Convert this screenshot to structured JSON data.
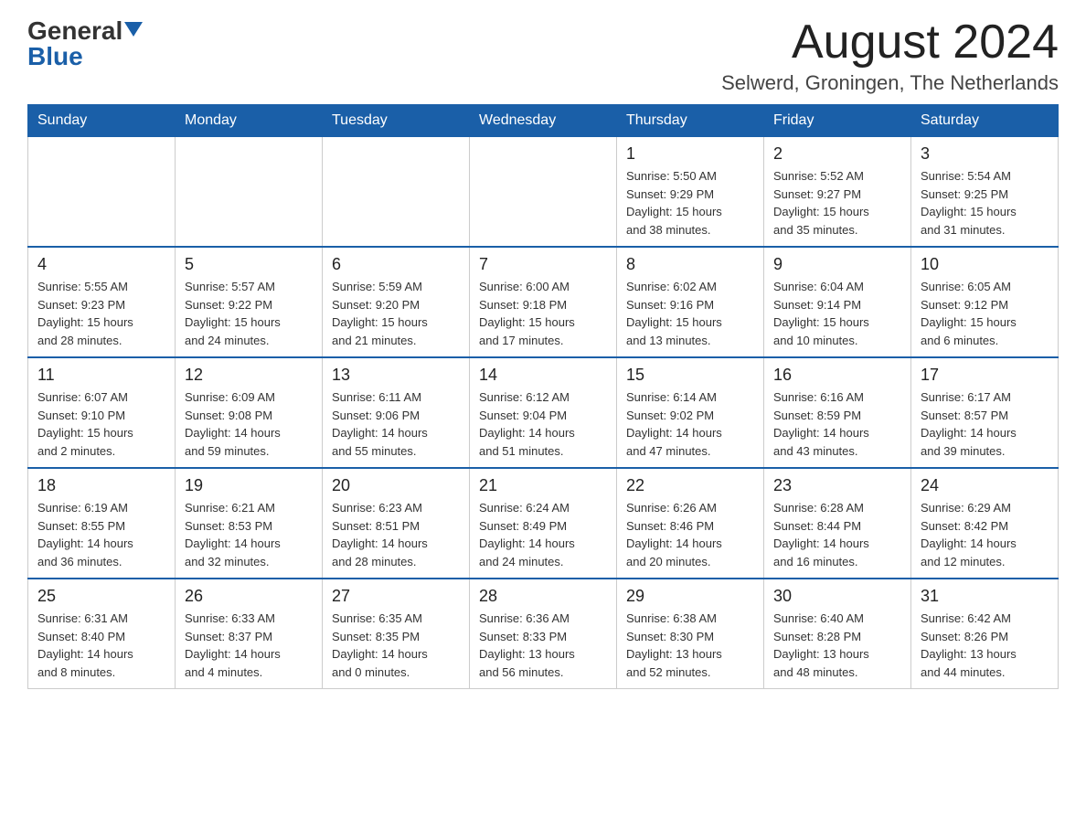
{
  "header": {
    "logo_general": "General",
    "logo_blue": "Blue",
    "month_title": "August 2024",
    "location": "Selwerd, Groningen, The Netherlands"
  },
  "weekdays": [
    "Sunday",
    "Monday",
    "Tuesday",
    "Wednesday",
    "Thursday",
    "Friday",
    "Saturday"
  ],
  "weeks": [
    [
      {
        "day": "",
        "info": ""
      },
      {
        "day": "",
        "info": ""
      },
      {
        "day": "",
        "info": ""
      },
      {
        "day": "",
        "info": ""
      },
      {
        "day": "1",
        "info": "Sunrise: 5:50 AM\nSunset: 9:29 PM\nDaylight: 15 hours\nand 38 minutes."
      },
      {
        "day": "2",
        "info": "Sunrise: 5:52 AM\nSunset: 9:27 PM\nDaylight: 15 hours\nand 35 minutes."
      },
      {
        "day": "3",
        "info": "Sunrise: 5:54 AM\nSunset: 9:25 PM\nDaylight: 15 hours\nand 31 minutes."
      }
    ],
    [
      {
        "day": "4",
        "info": "Sunrise: 5:55 AM\nSunset: 9:23 PM\nDaylight: 15 hours\nand 28 minutes."
      },
      {
        "day": "5",
        "info": "Sunrise: 5:57 AM\nSunset: 9:22 PM\nDaylight: 15 hours\nand 24 minutes."
      },
      {
        "day": "6",
        "info": "Sunrise: 5:59 AM\nSunset: 9:20 PM\nDaylight: 15 hours\nand 21 minutes."
      },
      {
        "day": "7",
        "info": "Sunrise: 6:00 AM\nSunset: 9:18 PM\nDaylight: 15 hours\nand 17 minutes."
      },
      {
        "day": "8",
        "info": "Sunrise: 6:02 AM\nSunset: 9:16 PM\nDaylight: 15 hours\nand 13 minutes."
      },
      {
        "day": "9",
        "info": "Sunrise: 6:04 AM\nSunset: 9:14 PM\nDaylight: 15 hours\nand 10 minutes."
      },
      {
        "day": "10",
        "info": "Sunrise: 6:05 AM\nSunset: 9:12 PM\nDaylight: 15 hours\nand 6 minutes."
      }
    ],
    [
      {
        "day": "11",
        "info": "Sunrise: 6:07 AM\nSunset: 9:10 PM\nDaylight: 15 hours\nand 2 minutes."
      },
      {
        "day": "12",
        "info": "Sunrise: 6:09 AM\nSunset: 9:08 PM\nDaylight: 14 hours\nand 59 minutes."
      },
      {
        "day": "13",
        "info": "Sunrise: 6:11 AM\nSunset: 9:06 PM\nDaylight: 14 hours\nand 55 minutes."
      },
      {
        "day": "14",
        "info": "Sunrise: 6:12 AM\nSunset: 9:04 PM\nDaylight: 14 hours\nand 51 minutes."
      },
      {
        "day": "15",
        "info": "Sunrise: 6:14 AM\nSunset: 9:02 PM\nDaylight: 14 hours\nand 47 minutes."
      },
      {
        "day": "16",
        "info": "Sunrise: 6:16 AM\nSunset: 8:59 PM\nDaylight: 14 hours\nand 43 minutes."
      },
      {
        "day": "17",
        "info": "Sunrise: 6:17 AM\nSunset: 8:57 PM\nDaylight: 14 hours\nand 39 minutes."
      }
    ],
    [
      {
        "day": "18",
        "info": "Sunrise: 6:19 AM\nSunset: 8:55 PM\nDaylight: 14 hours\nand 36 minutes."
      },
      {
        "day": "19",
        "info": "Sunrise: 6:21 AM\nSunset: 8:53 PM\nDaylight: 14 hours\nand 32 minutes."
      },
      {
        "day": "20",
        "info": "Sunrise: 6:23 AM\nSunset: 8:51 PM\nDaylight: 14 hours\nand 28 minutes."
      },
      {
        "day": "21",
        "info": "Sunrise: 6:24 AM\nSunset: 8:49 PM\nDaylight: 14 hours\nand 24 minutes."
      },
      {
        "day": "22",
        "info": "Sunrise: 6:26 AM\nSunset: 8:46 PM\nDaylight: 14 hours\nand 20 minutes."
      },
      {
        "day": "23",
        "info": "Sunrise: 6:28 AM\nSunset: 8:44 PM\nDaylight: 14 hours\nand 16 minutes."
      },
      {
        "day": "24",
        "info": "Sunrise: 6:29 AM\nSunset: 8:42 PM\nDaylight: 14 hours\nand 12 minutes."
      }
    ],
    [
      {
        "day": "25",
        "info": "Sunrise: 6:31 AM\nSunset: 8:40 PM\nDaylight: 14 hours\nand 8 minutes."
      },
      {
        "day": "26",
        "info": "Sunrise: 6:33 AM\nSunset: 8:37 PM\nDaylight: 14 hours\nand 4 minutes."
      },
      {
        "day": "27",
        "info": "Sunrise: 6:35 AM\nSunset: 8:35 PM\nDaylight: 14 hours\nand 0 minutes."
      },
      {
        "day": "28",
        "info": "Sunrise: 6:36 AM\nSunset: 8:33 PM\nDaylight: 13 hours\nand 56 minutes."
      },
      {
        "day": "29",
        "info": "Sunrise: 6:38 AM\nSunset: 8:30 PM\nDaylight: 13 hours\nand 52 minutes."
      },
      {
        "day": "30",
        "info": "Sunrise: 6:40 AM\nSunset: 8:28 PM\nDaylight: 13 hours\nand 48 minutes."
      },
      {
        "day": "31",
        "info": "Sunrise: 6:42 AM\nSunset: 8:26 PM\nDaylight: 13 hours\nand 44 minutes."
      }
    ]
  ]
}
